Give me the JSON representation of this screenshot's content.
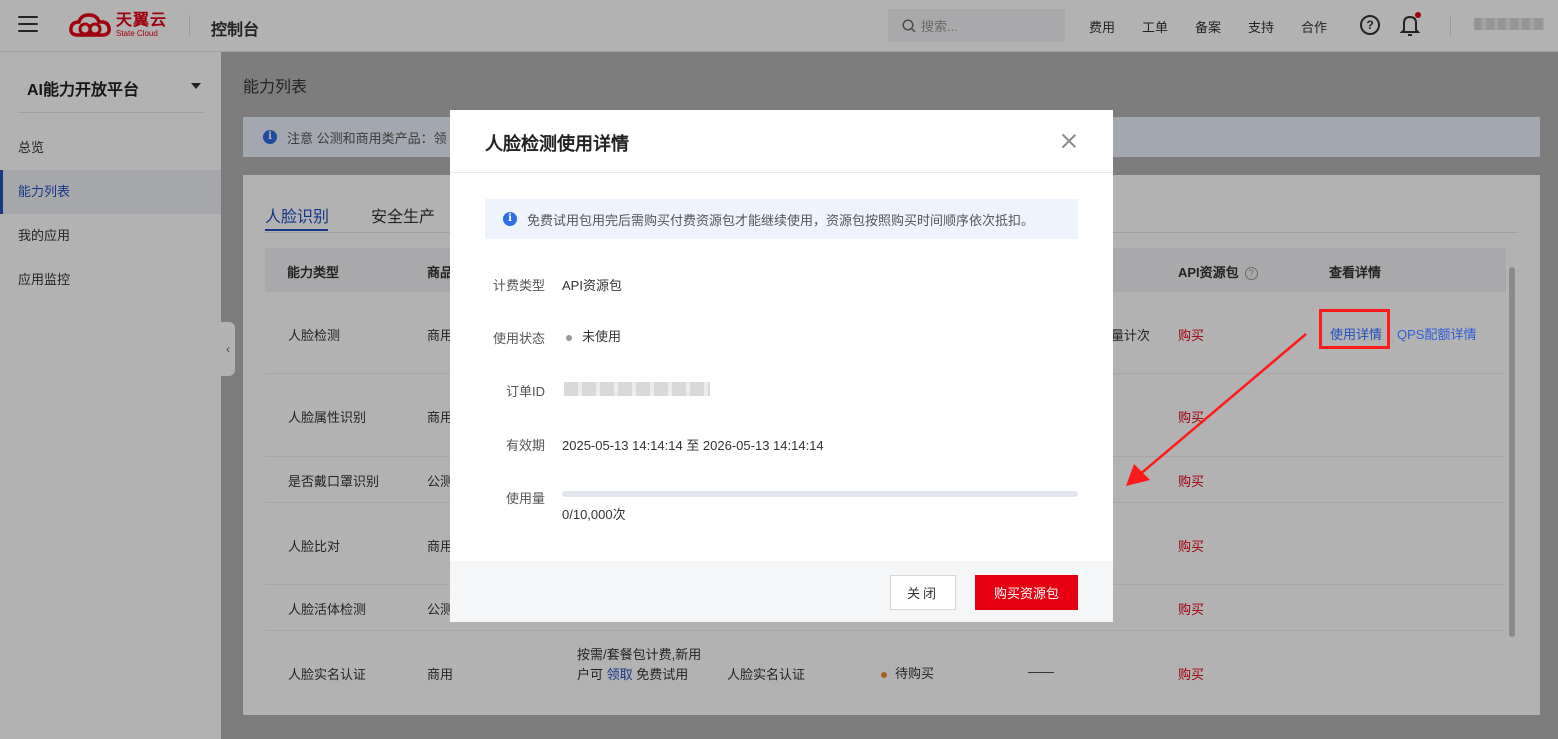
{
  "header": {
    "logo_cn": "天翼云",
    "logo_en": "State Cloud",
    "console_title": "控制台",
    "search_placeholder": "搜索...",
    "nav": [
      "费用",
      "工单",
      "备案",
      "支持",
      "合作"
    ]
  },
  "sidebar": {
    "title": "AI能力开放平台",
    "items": [
      {
        "label": "总览"
      },
      {
        "label": "能力列表"
      },
      {
        "label": "我的应用"
      },
      {
        "label": "应用监控"
      }
    ]
  },
  "main": {
    "page_title": "能力列表",
    "notice": "注意 公测和商用类产品：领",
    "tabs": [
      "人脸识别",
      "安全生产"
    ],
    "columns": {
      "type": "能力类型",
      "product": "商品",
      "api": "API资源包",
      "detail": "查看详情"
    },
    "rows": [
      {
        "name": "人脸检测",
        "product": "商用",
        "billing_tail": "量计次",
        "buy": "购买"
      },
      {
        "name": "人脸属性识别",
        "product": "商用",
        "buy": "购买"
      },
      {
        "name": "是否戴口罩识别",
        "product": "公测",
        "buy": "购买"
      },
      {
        "name": "人脸比对",
        "product": "商用",
        "buy": "购买"
      },
      {
        "name": "人脸活体检测",
        "product": "公测",
        "buy": "购买"
      },
      {
        "name": "人脸实名认证",
        "product": "商用",
        "billing_1": "按需/套餐包计费,新用",
        "billing_2a": "户可",
        "billing_2b": "领取",
        "billing_2c": "免费试用",
        "ability": "人脸实名认证",
        "status": "待购买",
        "dash": "——",
        "buy": "购买"
      }
    ],
    "detail_link": "使用详情",
    "qps_link": "QPS配额详情"
  },
  "modal": {
    "title": "人脸检测使用详情",
    "notice": "免费试用包用完后需购买付费资源包才能继续使用，资源包按照购买时间顺序依次抵扣。",
    "fields": {
      "billing_label": "计费类型",
      "billing_value": "API资源包",
      "status_label": "使用状态",
      "status_value": "未使用",
      "order_label": "订单ID",
      "validity_label": "有效期",
      "validity_value": "2025-05-13 14:14:14 至 2026-05-13 14:14:14",
      "usage_label": "使用量",
      "usage_value": "0/10,000次"
    },
    "usage_fraction": 0,
    "close_button": "关闭",
    "buy_button": "购买资源包"
  },
  "colors": {
    "brand_red": "#e60012",
    "link_blue": "#1f4fc3",
    "annotation_red": "#ff1a1a"
  }
}
